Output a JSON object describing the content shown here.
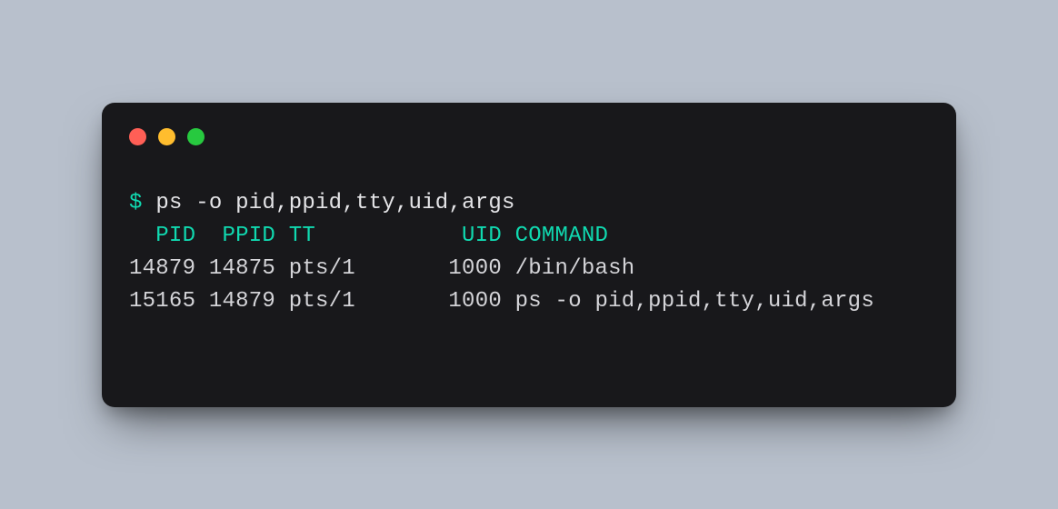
{
  "terminal": {
    "prompt": "$",
    "command": "ps -o pid,ppid,tty,uid,args",
    "header": "  PID  PPID TT           UID COMMAND",
    "rows": [
      "14879 14875 pts/1       1000 /bin/bash",
      "15165 14879 pts/1       1000 ps -o pid,ppid,tty,uid,args"
    ]
  }
}
